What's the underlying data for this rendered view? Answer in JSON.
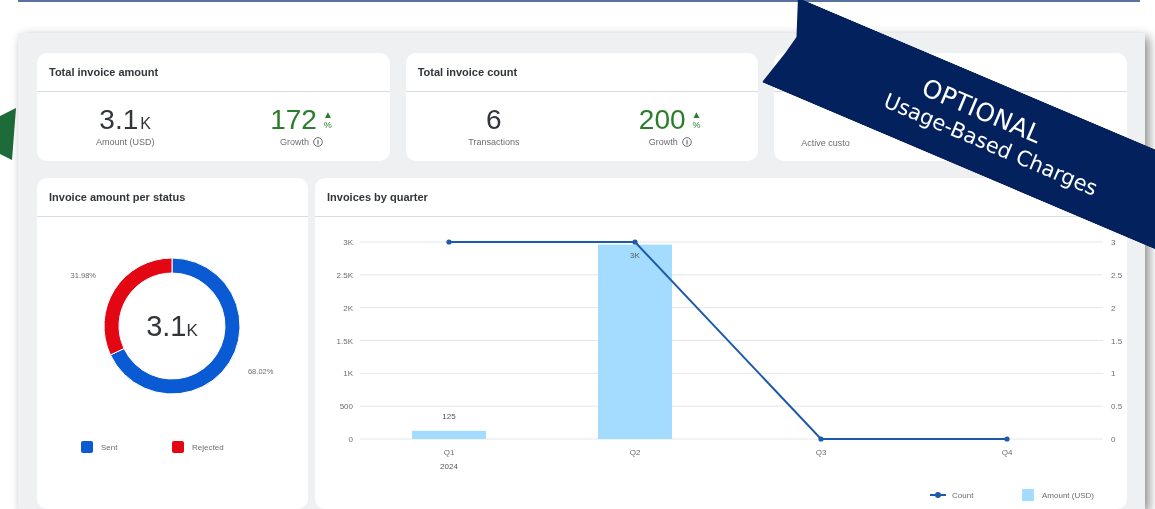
{
  "kpis": [
    {
      "title": "Total invoice amount",
      "value": "3.1",
      "unit": "K",
      "label": "Amount (USD)",
      "growth": {
        "value": "172",
        "unit": "%",
        "trend": "▲",
        "label": "Growth"
      }
    },
    {
      "title": "Total invoice count",
      "value": "6",
      "label": "Transactions",
      "growth": {
        "value": "200",
        "unit": "%",
        "trend": "▲",
        "label": "Growth"
      }
    },
    {
      "label": "Active custo"
    }
  ],
  "status_card": {
    "title": "Invoice amount per status",
    "center": {
      "value": "3.1",
      "unit": "K"
    },
    "chart_data": {
      "type": "donut",
      "categories": [
        "Sent",
        "Rejected"
      ],
      "values": [
        68.02,
        31.98
      ],
      "colors": [
        "#0a5bd3",
        "#e30613"
      ],
      "value_labels": [
        "68.02%",
        "31.98%"
      ],
      "legend": "bottom"
    }
  },
  "quarter_card": {
    "title": "Invoices by quarter",
    "chart_data": {
      "type": "bar",
      "categories": [
        {
          "label": "Q1",
          "year": "2024"
        },
        {
          "label": "Q2"
        },
        {
          "label": "Q3"
        },
        {
          "label": "Q4"
        }
      ],
      "series": [
        {
          "name": "Amount (USD)",
          "color": "#a3dcff",
          "values": [
            125,
            2960,
            0,
            0
          ],
          "value_labels": [
            "125",
            "3K",
            null,
            null
          ]
        },
        {
          "name": "Count",
          "type": "line",
          "axis": "y2",
          "color": "#1d5aab",
          "values": [
            3,
            3,
            0,
            0
          ]
        }
      ],
      "grid": true,
      "legend": "bottom",
      "ylim": [
        0,
        3000
      ],
      "y2lim": [
        0,
        3
      ],
      "yticks": [
        {
          "value": 0,
          "label": "0"
        },
        {
          "value": 500,
          "label": "500"
        },
        {
          "value": 1000,
          "label": "1K"
        },
        {
          "value": 1500,
          "label": "1.5K"
        },
        {
          "value": 2000,
          "label": "2K"
        },
        {
          "value": 2500,
          "label": "2.5K"
        },
        {
          "value": 3000,
          "label": "3K"
        }
      ],
      "y2ticks": [
        {
          "value": 0,
          "label": "0"
        },
        {
          "value": 0.5,
          "label": "0.5"
        },
        {
          "value": 1,
          "label": "1"
        },
        {
          "value": 1.5,
          "label": "1.5"
        },
        {
          "value": 2,
          "label": "2"
        },
        {
          "value": 2.5,
          "label": "2.5"
        },
        {
          "value": 3,
          "label": "3"
        }
      ]
    }
  },
  "banner": {
    "lines": [
      "OPTIONAL",
      "Usage-Based Charges"
    ]
  }
}
